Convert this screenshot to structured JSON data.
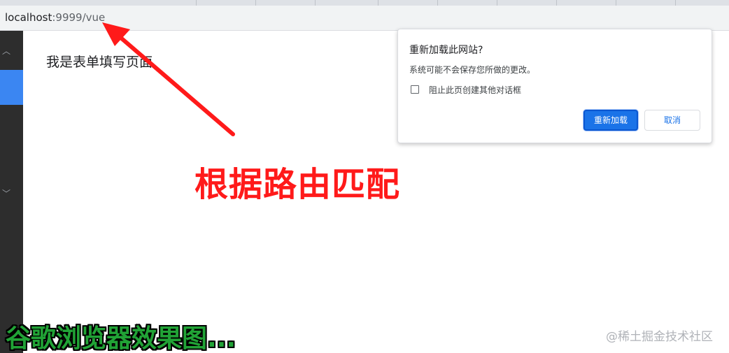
{
  "browser": {
    "url_host": "localhost",
    "url_path": ":9999/vue"
  },
  "page": {
    "heading": "我是表单填写页面"
  },
  "dialog": {
    "title": "重新加载此网站?",
    "message": "系统可能不会保存您所做的更改。",
    "checkbox_label": "阻止此页创建其他对话框",
    "checkbox_checked": false,
    "reload_label": "重新加载",
    "cancel_label": "取消"
  },
  "annotations": {
    "red_text": "根据路由匹配",
    "green_text": "谷歌浏览器效果图...",
    "watermark": "@稀土掘金技术社区"
  },
  "colors": {
    "primary_button": "#1a73e8",
    "annotation_red": "#ff1a1a",
    "annotation_green": "#21a336",
    "sidebar_highlight": "#3b86f2"
  },
  "icons": {
    "sidebar_top": "chevron-up-icon",
    "sidebar_mid": "chevron-down-icon"
  }
}
